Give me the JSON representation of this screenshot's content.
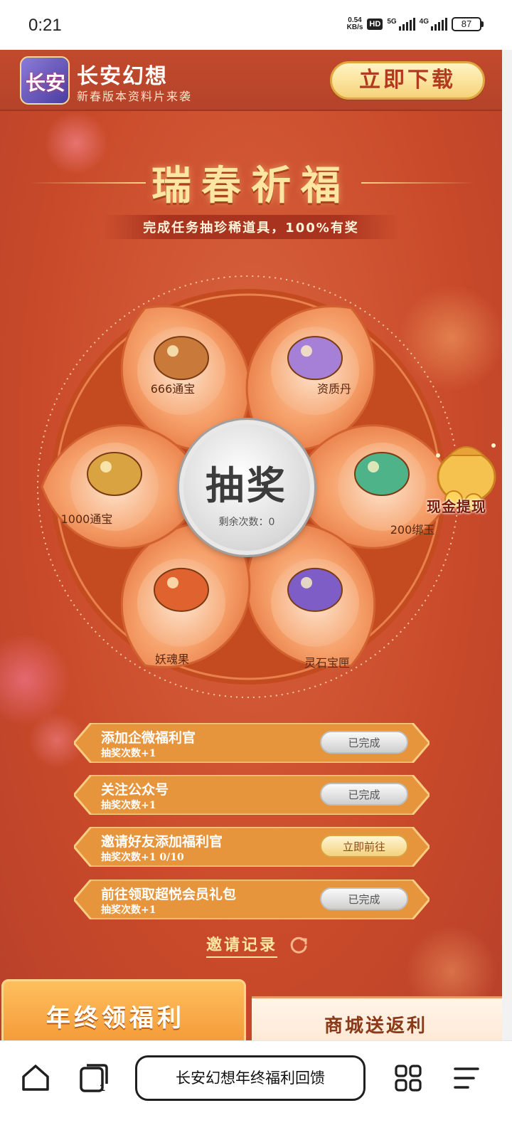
{
  "status_bar": {
    "time": "0:21",
    "net_speed_value": "0.54",
    "net_speed_unit": "KB/s",
    "hd_badge": "HD",
    "signal_1_label": "5G",
    "signal_2_label": "4G",
    "battery": "87"
  },
  "app_banner": {
    "logo_text": "长安",
    "name": "长安幻想",
    "subtitle": "新春版本资料片来袭",
    "download_label": "立即下载"
  },
  "event": {
    "title": "瑞春祈福",
    "subtitle": "完成任务抽珍稀道具，100%有奖"
  },
  "wheel": {
    "draw_label": "抽奖",
    "remaining": "剩余次数：0",
    "prizes": [
      {
        "label": "666通宝",
        "icon": "treasure-chest-icon"
      },
      {
        "label": "资质丹",
        "icon": "pouch-icon"
      },
      {
        "label": "200绑玉",
        "icon": "jade-icon"
      },
      {
        "label": "灵石宝匣",
        "icon": "gem-chest-icon"
      },
      {
        "label": "妖魂果",
        "icon": "spirit-fruit-icon"
      },
      {
        "label": "1000通宝",
        "icon": "gold-pot-icon"
      }
    ],
    "cash_badge": "现金提现"
  },
  "tasks": [
    {
      "title": "添加企微福利官",
      "sub": "抽奖次数+1",
      "status": "已完成"
    },
    {
      "title": "关注公众号",
      "sub": "抽奖次数+1",
      "status": "已完成"
    },
    {
      "title": "邀请好友添加福利官",
      "sub": "抽奖次数+1   0/10",
      "status": "立即前往"
    },
    {
      "title": "前往领取超悦会员礼包",
      "sub": "抽奖次数+1",
      "status": "已完成"
    }
  ],
  "invite_record": "邀请记录",
  "bottom_tabs": {
    "left": "年终领福利",
    "right": "商城送返利"
  },
  "browser": {
    "page_title": "长安幻想年终福利回馈"
  },
  "colors": {
    "page_bg": "#c94a2a",
    "gold_text": "#fde6a2",
    "petal": "#f0884f",
    "task_done_btn": "#d9d9d9",
    "task_go_btn": "#f4d27d"
  }
}
